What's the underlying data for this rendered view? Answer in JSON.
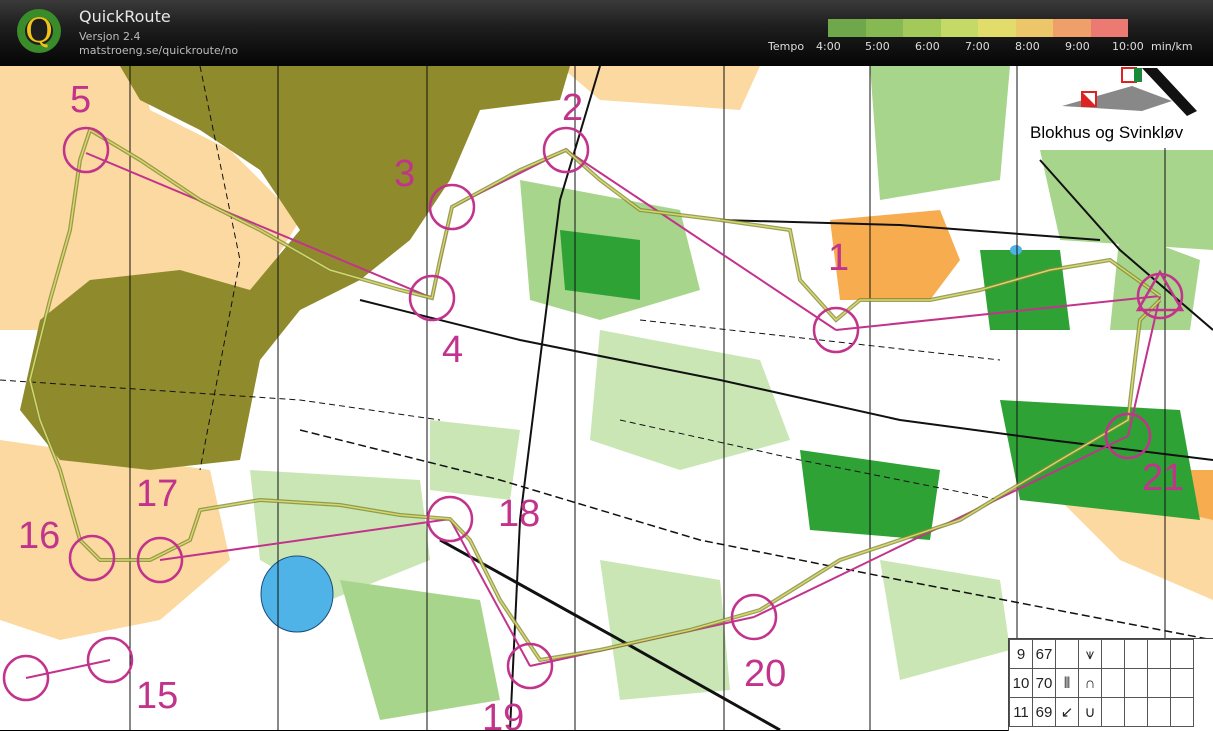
{
  "app": {
    "title": "QuickRoute",
    "version": "Versjon 2.4",
    "url": "matstroeng.se/quickroute/no"
  },
  "tempo": {
    "label": "Tempo",
    "ticks": [
      "4:00",
      "5:00",
      "6:00",
      "7:00",
      "8:00",
      "9:00",
      "10:00"
    ],
    "unit": "min/km",
    "colors": [
      "#6fa84b",
      "#86b951",
      "#a2c95a",
      "#c5d966",
      "#e2dd6a",
      "#eec66a",
      "#ee9f6a",
      "#ec7a72"
    ]
  },
  "map": {
    "title": "Blokhus og Svinkløv",
    "controls": [
      "1",
      "2",
      "3",
      "4",
      "5",
      "15",
      "16",
      "17",
      "18",
      "19",
      "20",
      "21"
    ],
    "colors": {
      "forest": "#ffffff",
      "open": "#fbd9a0",
      "green": "#a8d58c",
      "dark_green": "#2fa236",
      "olive": "#8f8a2c",
      "course": "#c2338c",
      "route": "#7d8a3a",
      "water": "#4fb3e8",
      "orange": "#f7ad4f"
    }
  },
  "legend": {
    "rows": [
      {
        "code": "9",
        "num": "67"
      },
      {
        "code": "10",
        "num": "70"
      },
      {
        "code": "11",
        "num": "69"
      }
    ]
  }
}
